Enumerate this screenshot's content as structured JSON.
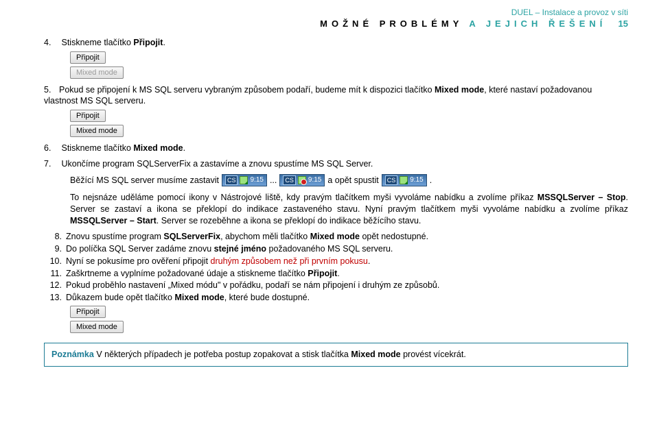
{
  "header": {
    "title": "DUEL – Instalace a provoz v síti",
    "line1": "MOŽNÉ PROBLÉMY",
    "line2": "A JEJICH ŘEŠENÍ",
    "page": "15"
  },
  "step4": {
    "num": "4.",
    "text_a": "Stiskneme tlačítko ",
    "text_b": "Připojit",
    "text_c": "."
  },
  "buttons": {
    "pripojit": "Připojit",
    "mixed": "Mixed mode"
  },
  "step5": {
    "num": "5.",
    "text_a": "Pokud se připojení k MS SQL serveru vybraným způsobem podaří, budeme mít k dispozici tlačítko ",
    "text_b": "Mixed mode",
    "text_c": ", které nastaví požadovanou vlastnost MS SQL serveru."
  },
  "step6": {
    "num": "6.",
    "text_a": "Stiskneme tlačítko ",
    "text_b": "Mixed mode",
    "text_c": "."
  },
  "step7": {
    "num": "7.",
    "text_a": "Ukončíme program SQLServerFix a zastavíme a znovu spustíme MS SQL Server."
  },
  "running": {
    "intro": "Běžící MS SQL server musíme zastavit",
    "lang": "CS",
    "time": "9:15",
    "ellipsis": "...",
    "mid": "a opět spustit",
    "dot": "."
  },
  "para7": {
    "a": "To nejsnáze uděláme pomocí ikony v Nástrojové liště, kdy pravým tlačítkem myši vyvoláme nabídku a zvolíme příkaz ",
    "b": "MSSQLServer – Stop",
    "c": ". Server se zastaví a ikona se překlopí do indikace zastaveného stavu. Nyní pravým tlačítkem myši vyvoláme nabídku a zvolíme příkaz ",
    "d": "MSSQLServer – Start",
    "e": ". Server se rozeběhne a ikona se překlopí do indikace běžícího stavu."
  },
  "step8": {
    "num": "8.",
    "a": "Znovu spustíme program ",
    "b": "SQLServerFix",
    "c": ", abychom měli tlačítko ",
    "d": "Mixed mode",
    "e": " opět nedostupné."
  },
  "step9": {
    "num": "9.",
    "a": "Do políčka SQL Server zadáme znovu ",
    "b": "stejné jméno",
    "c": " požadovaného MS SQL serveru."
  },
  "step10": {
    "num": "10.",
    "a": "Nyní se pokusíme pro ověření připojit ",
    "b": "druhým způsobem než při prvním pokusu",
    "c": "."
  },
  "step11": {
    "num": "11.",
    "a": "Zaškrtneme a vyplníme požadované údaje a stiskneme tlačítko ",
    "b": "Připojit",
    "c": "."
  },
  "step12": {
    "num": "12.",
    "a": "Pokud proběhlo nastavení „Mixed módu\" v pořádku, podaří se nám připojení i druhým ze způsobů."
  },
  "step13": {
    "num": "13.",
    "a": "Důkazem bude opět tlačítko ",
    "b": "Mixed mode",
    "c": ", které bude dostupné."
  },
  "note": {
    "label": "Poznámka",
    "a": " V některých případech je potřeba postup zopakovat a stisk tlačítka ",
    "b": "Mixed mode",
    "c": " provést vícekrát."
  }
}
